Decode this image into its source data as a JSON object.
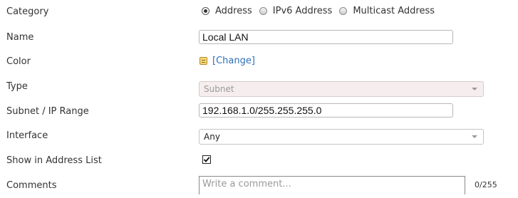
{
  "form": {
    "category": {
      "label": "Category",
      "options": [
        "Address",
        "IPv6 Address",
        "Multicast Address"
      ],
      "selected": "Address"
    },
    "name": {
      "label": "Name",
      "value": "Local LAN"
    },
    "color": {
      "label": "Color",
      "swatch_color": "#f5d77a",
      "change_link": "[Change]"
    },
    "type": {
      "label": "Type",
      "value": "Subnet",
      "disabled": true
    },
    "subnet": {
      "label": "Subnet / IP Range",
      "value": "192.168.1.0/255.255.255.0"
    },
    "interface": {
      "label": "Interface",
      "value": "Any"
    },
    "show_in_address_list": {
      "label": "Show in Address List",
      "checked": true
    },
    "comments": {
      "label": "Comments",
      "placeholder": "Write a comment...",
      "counter": "0/255"
    }
  },
  "colors": {
    "link": "#2d6fb7",
    "label_text": "#333333",
    "disabled_select_bg": "#f6eeee"
  }
}
